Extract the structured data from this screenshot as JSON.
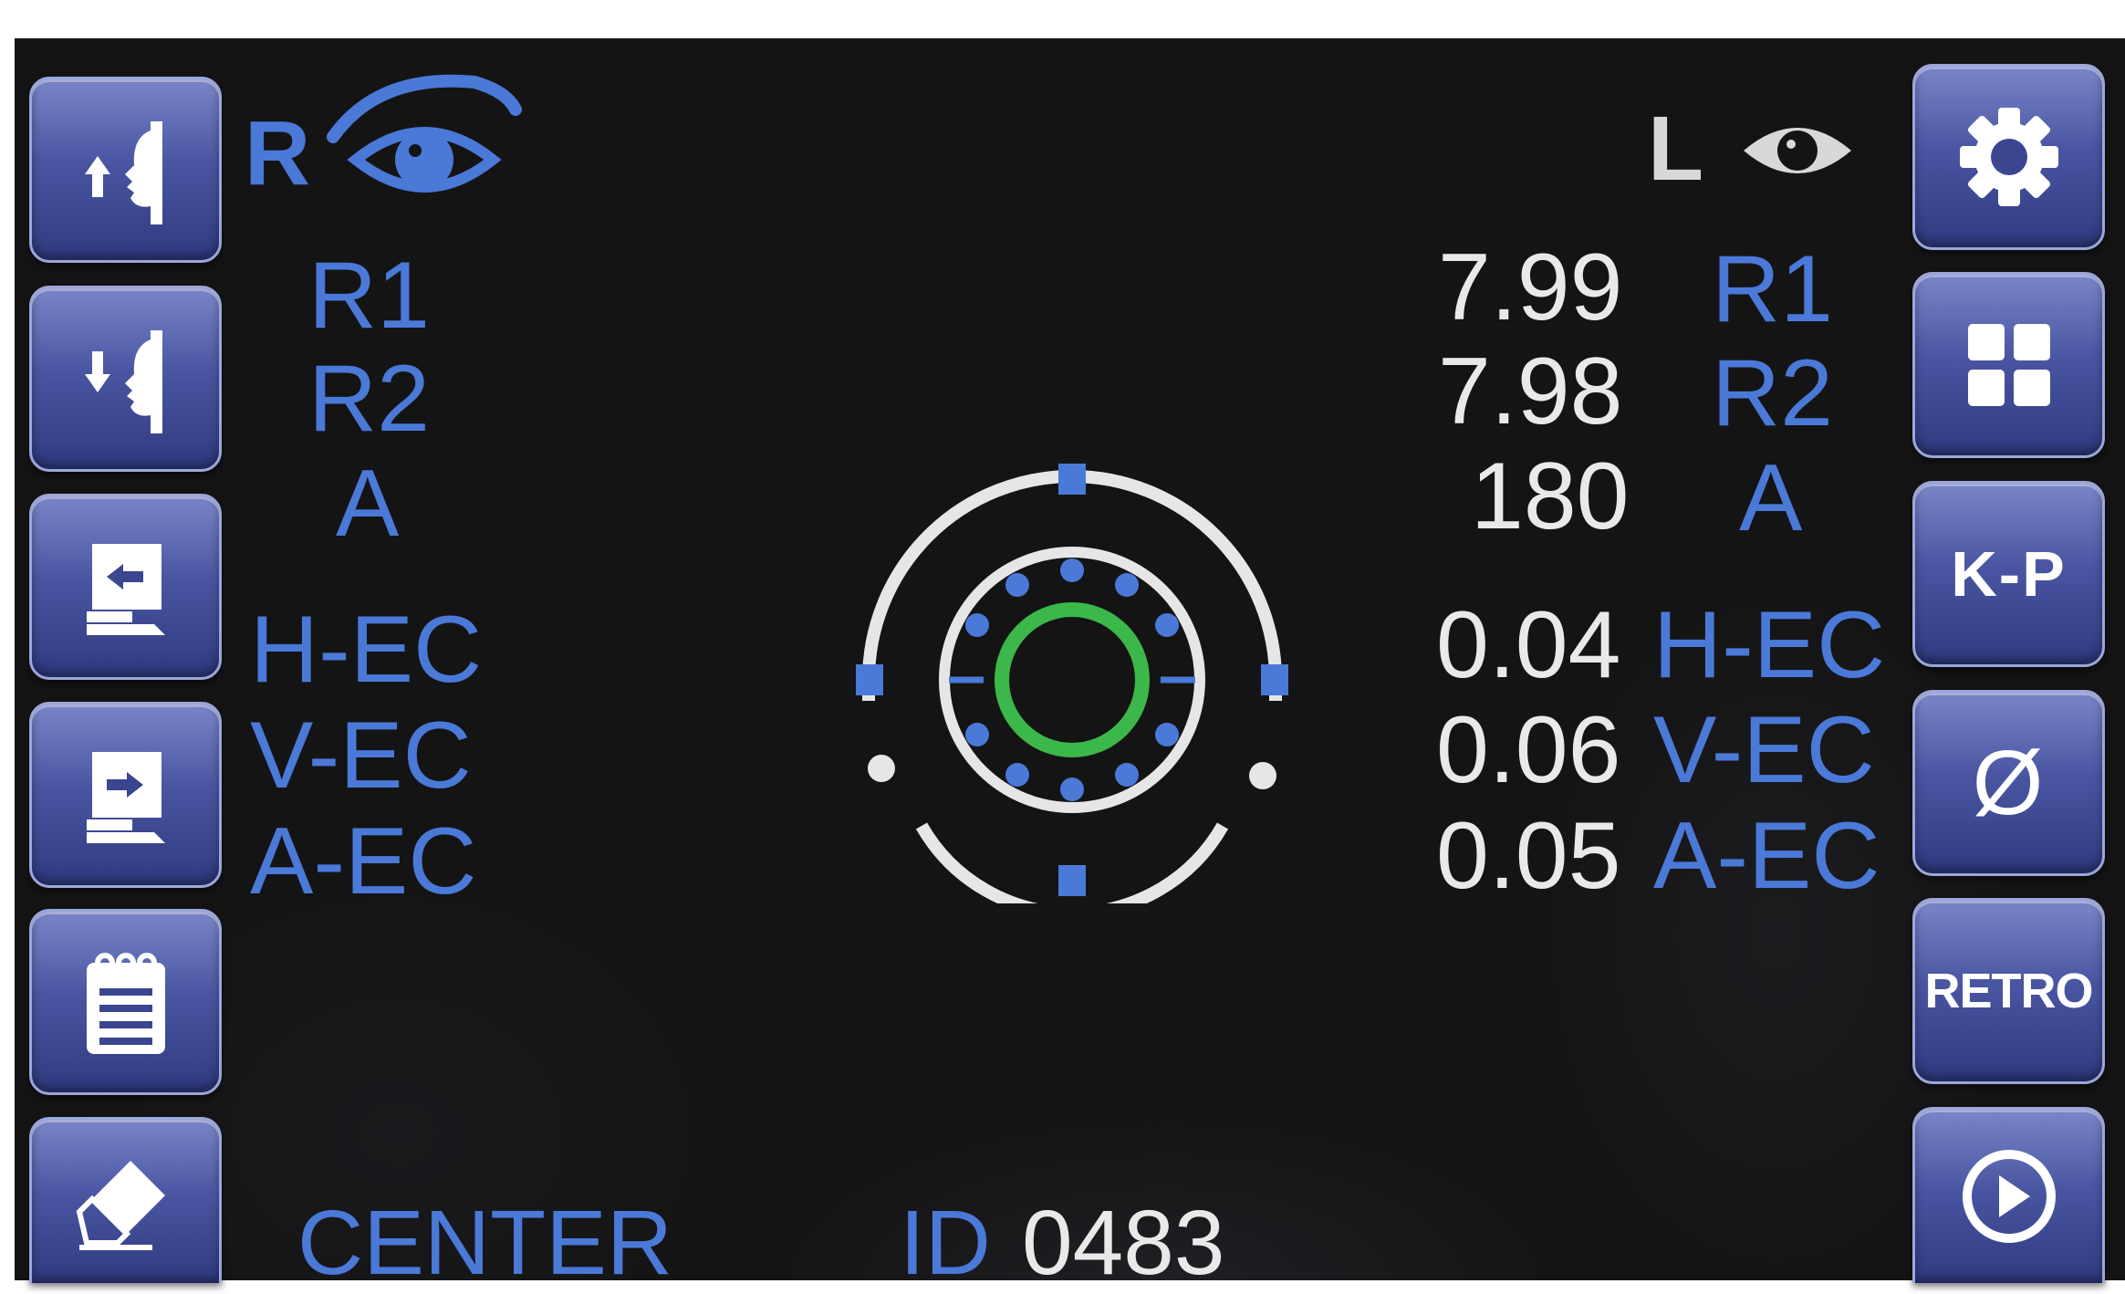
{
  "header": {
    "right_eye_letter": "R",
    "left_eye_letter": "L"
  },
  "left_panel": {
    "labels": [
      "R1",
      "R2",
      "A",
      "H-EC",
      "V-EC",
      "A-EC"
    ]
  },
  "right_panel": {
    "values": [
      "7.99",
      "7.98",
      "180",
      "0.04",
      "0.06",
      "0.05"
    ],
    "labels": [
      "R1",
      "R2",
      "A",
      "H-EC",
      "V-EC",
      "A-EC"
    ]
  },
  "footer": {
    "mode": "CENTER",
    "id_label": "ID",
    "id_value": "0483"
  },
  "left_buttons": [
    {
      "icon": "chin-rest-up-icon"
    },
    {
      "icon": "chin-rest-down-icon"
    },
    {
      "icon": "move-left-icon"
    },
    {
      "icon": "move-right-icon"
    },
    {
      "icon": "notepad-icon"
    },
    {
      "icon": "eraser-icon"
    }
  ],
  "right_buttons": [
    {
      "icon": "gear-icon"
    },
    {
      "icon": "grid-icon"
    },
    {
      "label": "K-P"
    },
    {
      "label": "Ø"
    },
    {
      "label": "RETRO"
    },
    {
      "icon": "play-icon"
    }
  ],
  "colors": {
    "label_blue": "#4a79d8",
    "value_white": "#e9e9e9",
    "button_blue": "#4a56a2",
    "target_green": "#3cb84a",
    "screen_bg": "#141414"
  }
}
